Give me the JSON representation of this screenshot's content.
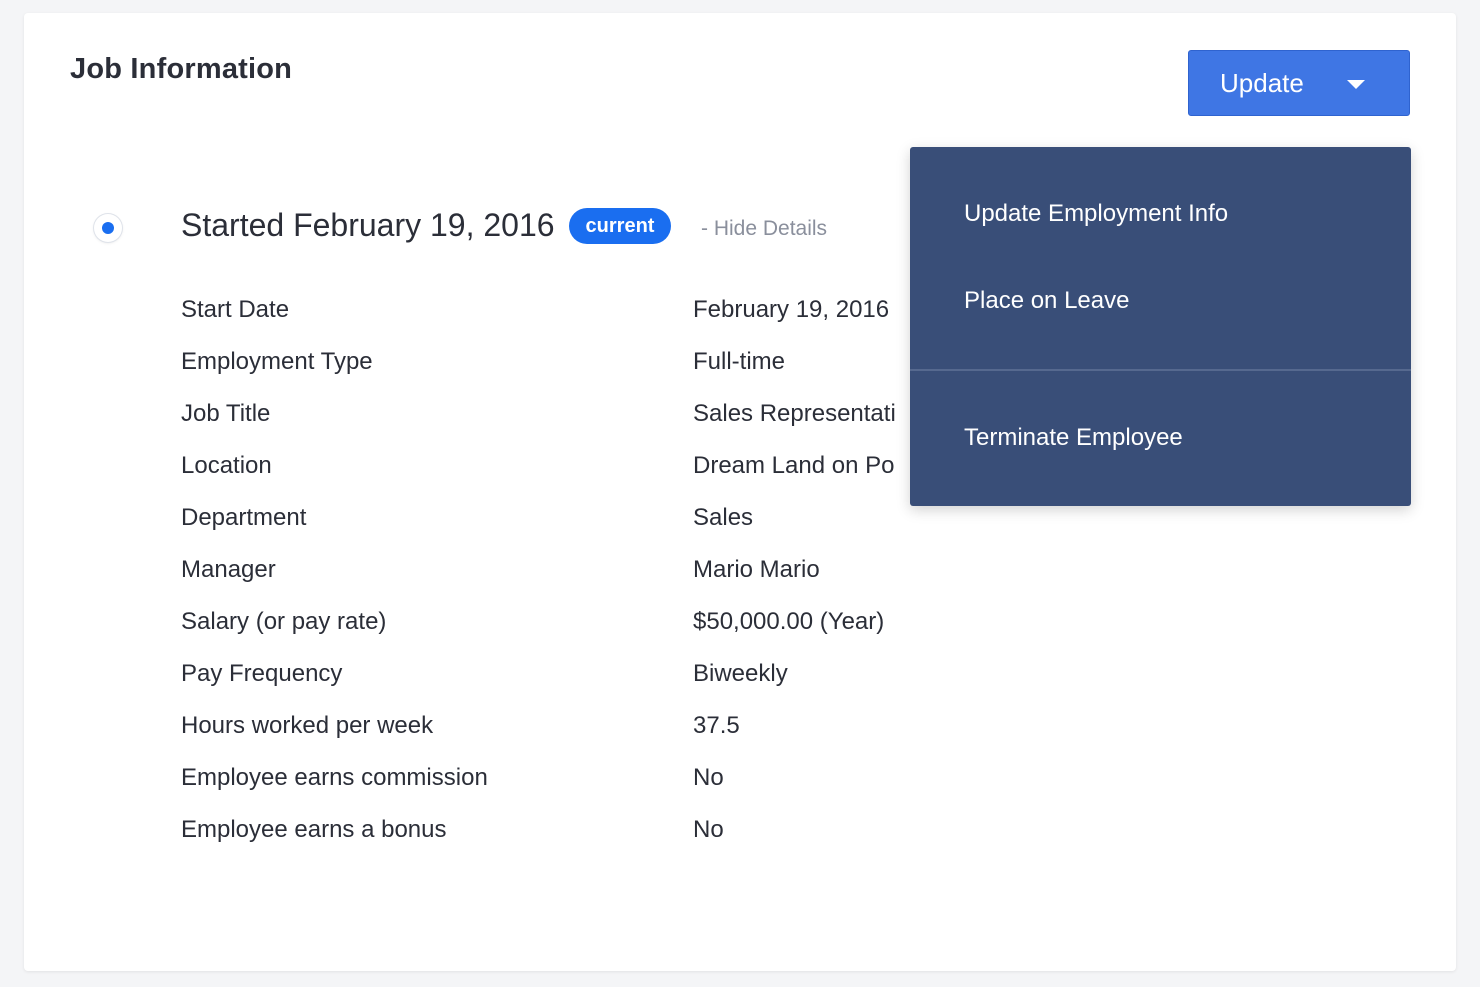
{
  "section": {
    "title": "Job Information"
  },
  "update_button": {
    "label": "Update"
  },
  "entry": {
    "title": "Started February 19, 2016",
    "badge": "current",
    "toggle_label": "- Hide Details"
  },
  "details": [
    {
      "label": "Start Date",
      "value": "February 19, 2016"
    },
    {
      "label": "Employment Type",
      "value": "Full-time"
    },
    {
      "label": "Job Title",
      "value": "Sales Representati"
    },
    {
      "label": "Location",
      "value": "Dream Land on Po"
    },
    {
      "label": "Department",
      "value": "Sales"
    },
    {
      "label": "Manager",
      "value": "Mario Mario"
    },
    {
      "label": "Salary (or pay rate)",
      "value": "$50,000.00 (Year)"
    },
    {
      "label": "Pay Frequency",
      "value": "Biweekly"
    },
    {
      "label": "Hours worked per week",
      "value": "37.5"
    },
    {
      "label": "Employee earns commission",
      "value": "No"
    },
    {
      "label": "Employee earns a bonus",
      "value": "No"
    }
  ],
  "dropdown_menu": {
    "items": [
      {
        "label": "Update Employment Info"
      },
      {
        "label": "Place on Leave"
      },
      {
        "label": "Terminate Employee"
      }
    ]
  },
  "colors": {
    "primary": "#3f76e4",
    "badge": "#1a6ef0",
    "menu_bg": "#394e78",
    "text": "#2b2e38",
    "muted": "#8a8f9c"
  }
}
